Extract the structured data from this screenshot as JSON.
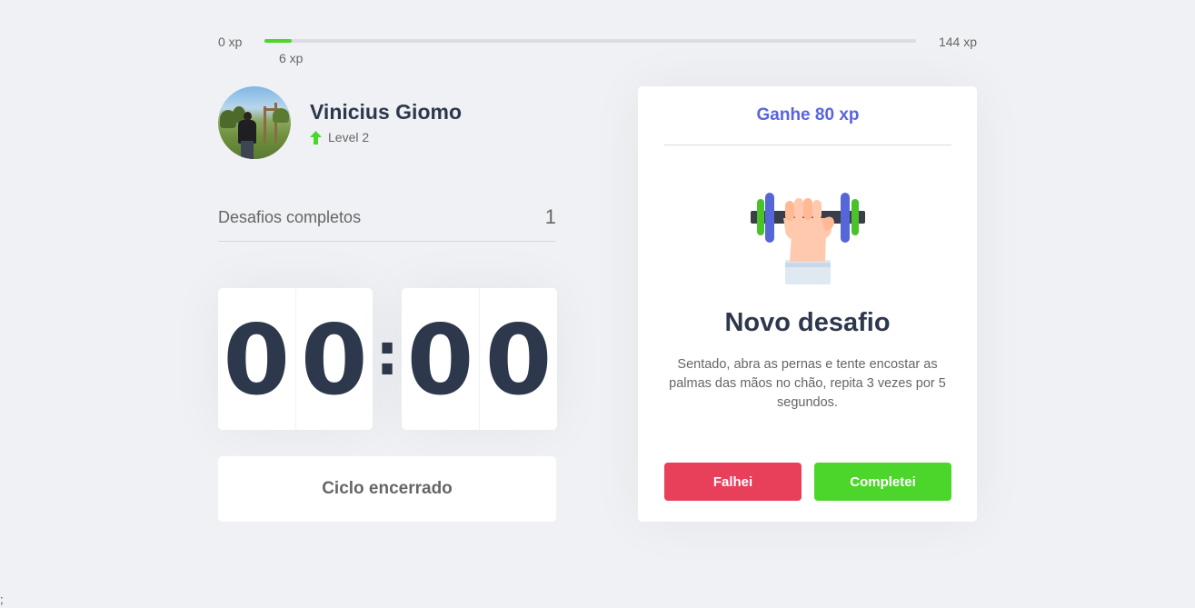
{
  "experience": {
    "min_label": "0 xp",
    "max_label": "144 xp",
    "current_label": "6 xp",
    "current": 6,
    "max": 144,
    "fill_color": "#4cd62b"
  },
  "profile": {
    "name": "Vinicius Giomo",
    "level_label": "Level 2",
    "level_icon": "level-up-arrow-icon",
    "avatar_icon": "user-photo"
  },
  "completed_challenges": {
    "label": "Desafios completos",
    "count": "1"
  },
  "countdown": {
    "minute_left": "0",
    "minute_right": "0",
    "separator": ":",
    "second_left": "0",
    "second_right": "0"
  },
  "cycle_button": {
    "label": "Ciclo encerrado"
  },
  "challenge": {
    "header": "Ganhe 80 xp",
    "image_icon": "dumbbell-body-icon",
    "title": "Novo desafio",
    "description": "Sentado, abra as pernas e tente encostar as palmas das mãos no chão, repita 3 vezes por 5 segundos.",
    "failed_label": "Falhei",
    "succeeded_label": "Completei"
  },
  "colors": {
    "background": "#f0f1f4",
    "title": "#2e384d",
    "text": "#666666",
    "blue": "#5965e0",
    "red": "#e83f5b",
    "green": "#4cd62b"
  },
  "stray_text": ";"
}
